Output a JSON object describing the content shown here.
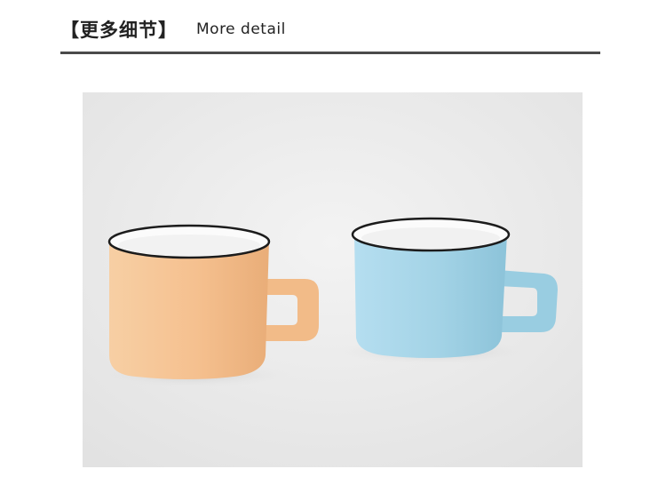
{
  "header": {
    "title_cn": "【更多细节】",
    "title_en": "More detail"
  },
  "photo": {
    "subject": "two-ceramic-cups",
    "colors": {
      "background": "#eeeeee",
      "cup_left": "#f6c79a",
      "cup_right": "#a6d6e8",
      "rim": "#1c1c1c",
      "interior": "#fbfbfb",
      "rule": "#4a4a4a"
    }
  }
}
